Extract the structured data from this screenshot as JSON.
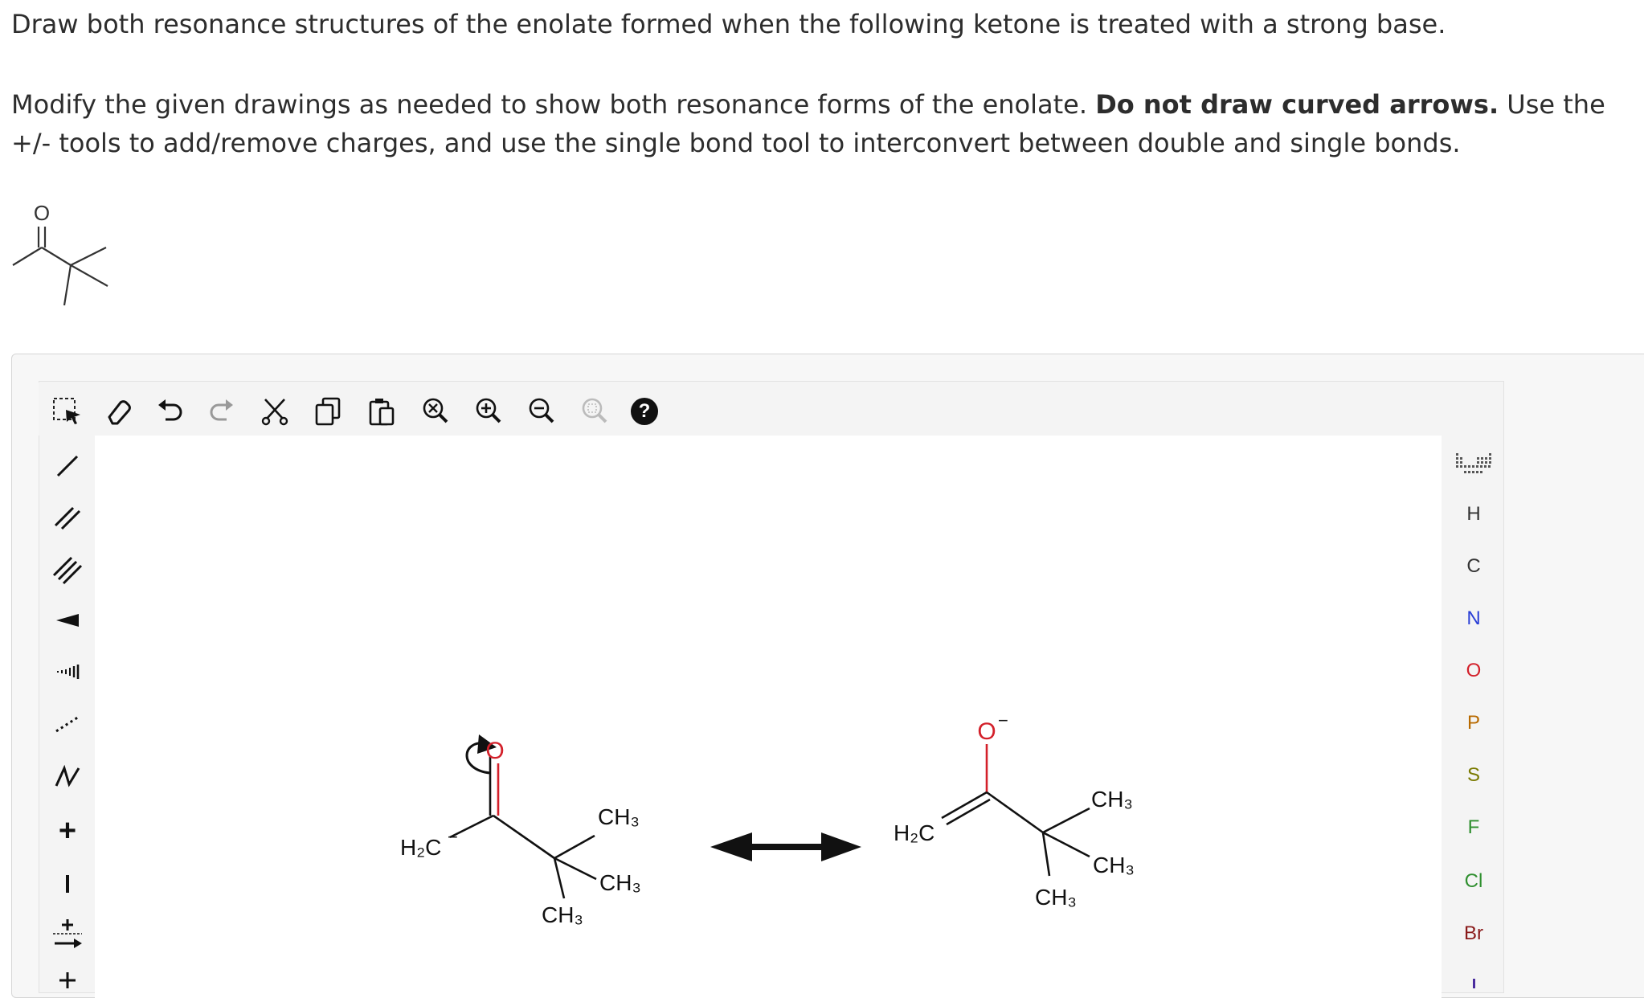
{
  "question": {
    "line1": "Draw both resonance structures of the enolate formed when the following ketone is treated with a strong base.",
    "instr_part1": "Modify the given drawings as needed to show both resonance forms of the enolate. ",
    "instr_bold": "Do not draw curved arrows.",
    "instr_part2": " Use the +/- tools to add/remove charges, and use the single bond tool to interconvert between double and single bonds."
  },
  "given_molecule": {
    "o_label": "O"
  },
  "top_toolbar": {
    "icons": [
      "select-icon",
      "eraser-icon",
      "undo-icon",
      "redo-icon",
      "cut-icon",
      "copy-icon",
      "paste-icon",
      "zoom-reset-icon",
      "zoom-in-icon",
      "zoom-out-icon",
      "zoom-fit-icon",
      "help-icon"
    ],
    "help_label": "?"
  },
  "left_toolbar": {
    "icons": [
      "single-bond-icon",
      "double-bond-icon",
      "triple-bond-icon",
      "wedge-bond-icon",
      "hash-bond-icon",
      "dashed-bond-icon",
      "chain-icon",
      "plus-charge-icon",
      "minus-charge-icon",
      "charge-shift-icon",
      "plus-icon-partial"
    ],
    "plus_label": "+",
    "minus_label": "−"
  },
  "element_panel": {
    "periodic_table_icon": "periodic-table-icon",
    "elements": [
      {
        "symbol": "H",
        "color": "#333333"
      },
      {
        "symbol": "C",
        "color": "#333333"
      },
      {
        "symbol": "N",
        "color": "#2a3fd6"
      },
      {
        "symbol": "O",
        "color": "#d3202a"
      },
      {
        "symbol": "P",
        "color": "#b86a00"
      },
      {
        "symbol": "S",
        "color": "#7a7a00"
      },
      {
        "symbol": "F",
        "color": "#2f8f2f"
      },
      {
        "symbol": "Cl",
        "color": "#2f8f2f"
      },
      {
        "symbol": "Br",
        "color": "#8a1a1a"
      }
    ]
  },
  "canvas": {
    "left": {
      "h2c": "H₂C",
      "h2c_charge": "−",
      "o_label": "O",
      "ch3_1": "CH₃",
      "ch3_2": "CH₃",
      "ch3_3": "CH₃"
    },
    "resonance_arrow": "resonance-arrow",
    "right": {
      "o_label": "O",
      "o_charge": "−",
      "h2c": "H₂C",
      "ch3_1": "CH₃",
      "ch3_2": "CH₃",
      "ch3_3": "CH₃"
    }
  },
  "colors": {
    "oxygen": "#d3202a",
    "accent": "#1a1a1a",
    "panel_bg": "#f7f7f7"
  }
}
